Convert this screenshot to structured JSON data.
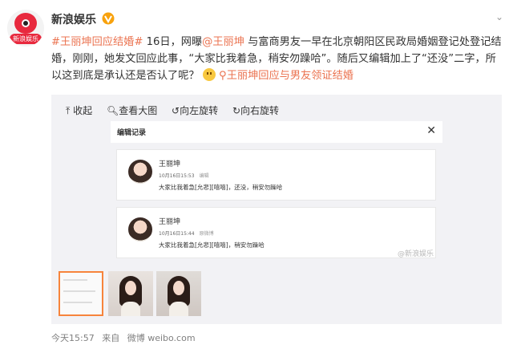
{
  "header": {
    "author": "新浪娱乐",
    "avatar_text": "新浪娱乐",
    "verified_icon": "verified-v-icon",
    "more_icon": "chevron-down-icon"
  },
  "post": {
    "topic": "#王丽坤回应结婚#",
    "text_1": " 16日，网曝",
    "mention": "@王丽坤",
    "text_2": " 与富商男友一早在北京朝阳区民政局婚姻登记处登记结婚，刚刚，她发文回应此事，“大家比我着急，稍安勿躁哈”。随后又编辑加上了“还没”二字，所以这到底是承认还是否认了呢？",
    "link_text": "王丽坤回应与男友领证结婚"
  },
  "media": {
    "toolbar": [
      "收起",
      "查看大图",
      "向左旋转",
      "向右旋转"
    ],
    "dialog_title": "编辑记录",
    "watermark": "@新浪娱乐",
    "cards": [
      {
        "name": "王丽坤",
        "time": "10月16日15:53",
        "source": "编辑",
        "text": "大家比我着急[允悲][嘻嘻]，还没，稍安勿躁哈"
      },
      {
        "name": "王丽坤",
        "time": "10月16日15:44",
        "source": "原微博",
        "text": "大家比我着急[允悲][嘻嘻]，稍安勿躁哈"
      }
    ]
  },
  "footer": {
    "time": "今天15:57",
    "from": "来自",
    "source": "微博 weibo.com"
  },
  "colors": {
    "accent": "#eb7350",
    "verified": "#f8a20d",
    "logo": "#e8293e"
  }
}
